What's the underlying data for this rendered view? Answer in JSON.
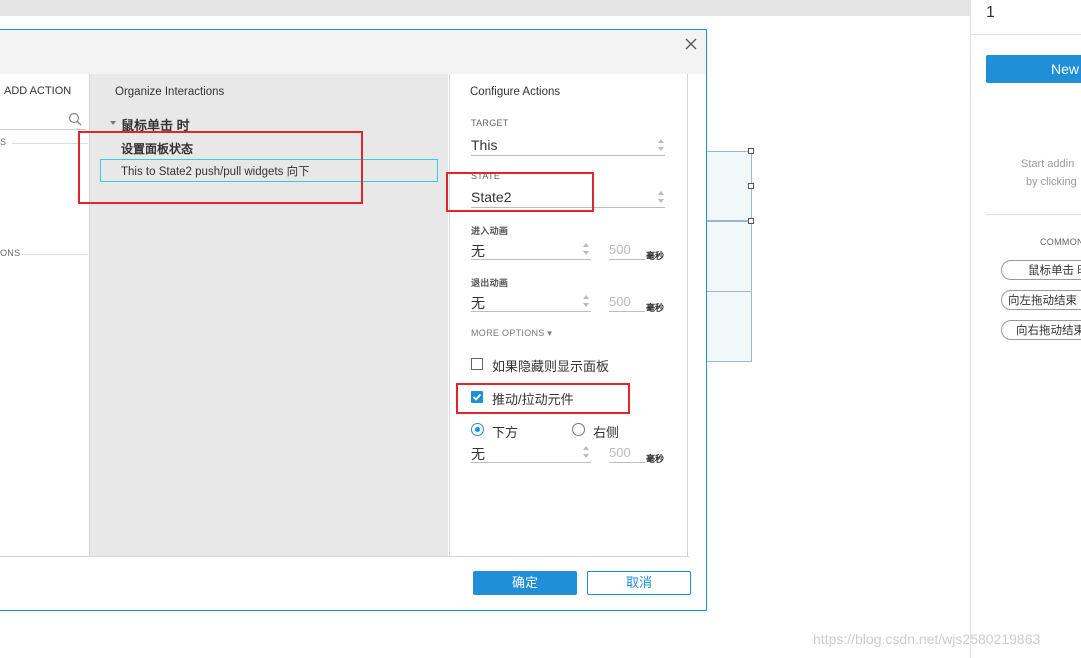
{
  "right_panel": {
    "page_number": "1",
    "new_button": "New",
    "hint_line1": "Start addin",
    "hint_line2": "by clicking",
    "common_label": "COMMON",
    "pills": [
      "鼠标单击 时",
      "向左拖动结束",
      "向右拖动结束"
    ]
  },
  "left_pane": {
    "add_action": "ADD ACTION",
    "section_a": "S",
    "section_b": "ONS"
  },
  "organize": {
    "title": "Organize Interactions",
    "event": "鼠标单击 时",
    "case": "设置面板状态",
    "action": "This to State2 push/pull widgets 向下"
  },
  "configure": {
    "title": "Configure Actions",
    "target_label": "TARGET",
    "target_value": "This",
    "state_label": "STATE",
    "state_value": "State2",
    "enter_anim_label": "进入动画",
    "enter_anim_value": "无",
    "enter_ms": "500",
    "exit_anim_label": "退出动画",
    "exit_anim_value": "无",
    "exit_ms": "500",
    "ms_unit": "毫秒",
    "more_options": "MORE OPTIONS ▾",
    "show_if_hidden": "如果隐藏则显示面板",
    "show_if_hidden_checked": false,
    "push_pull": "推动/拉动元件",
    "push_pull_checked": true,
    "dir_below": "下方",
    "dir_right": "右侧",
    "dir_selected": "下方",
    "push_anim_value": "无",
    "push_ms": "500"
  },
  "buttons": {
    "ok": "确定",
    "cancel": "取消"
  },
  "watermark": "https://blog.csdn.net/wjs2580219863",
  "colors": {
    "accent": "#1e8fd8",
    "highlight_red": "#e0252b",
    "selection_cyan": "#2fd1d8"
  }
}
